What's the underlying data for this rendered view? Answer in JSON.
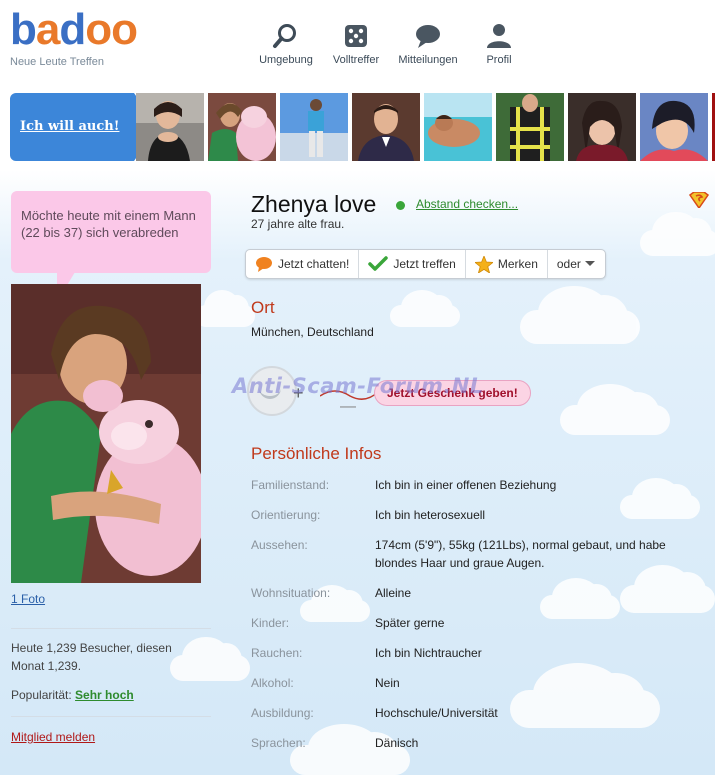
{
  "header": {
    "logo_letters": [
      "b",
      "a",
      "d",
      "o",
      "o"
    ],
    "tagline": "Neue Leute Treffen",
    "nav": [
      {
        "label": "Umgebung",
        "icon": "magnifier-icon"
      },
      {
        "label": "Volltreffer",
        "icon": "dice-icon"
      },
      {
        "label": "Mitteilungen",
        "icon": "speech-bubble-icon"
      },
      {
        "label": "Profil",
        "icon": "person-icon"
      }
    ]
  },
  "strip": {
    "cta": "Ich will auch!",
    "thumbnails": 8
  },
  "sidebar": {
    "status_bubble": "Möchte heute mit einem Mann (22 bis 37) sich verabreden",
    "photo_count_link": "1 Foto",
    "visitors": "Heute 1,239 Besucher, diesen Monat 1,239.",
    "popularity_label": "Popularität:",
    "popularity_value": "Sehr hoch",
    "report_link": "Mitglied melden"
  },
  "profile": {
    "name": "Zhenya love",
    "distance_link": "Abstand checken...",
    "age_line": "27 jahre alte frau.",
    "actions": [
      {
        "label": "Jetzt chatten!",
        "icon": "chat-bubble-icon"
      },
      {
        "label": "Jetzt treffen",
        "icon": "checkmark-icon"
      },
      {
        "label": "Merken",
        "icon": "star-icon"
      },
      {
        "label": "oder",
        "icon": "chevron-down-icon"
      }
    ],
    "location_heading": "Ort",
    "location": "München, Deutschland",
    "gift_button": "Jetzt Geschenk geben!",
    "plus": "+",
    "minus": "—",
    "watermark": "Anti-Scam-Forum.NL",
    "personal_heading": "Persönliche Infos",
    "info": [
      {
        "key": "Familienstand:",
        "value": "Ich bin in einer offenen Beziehung"
      },
      {
        "key": "Orientierung:",
        "value": "Ich bin heterosexuell"
      },
      {
        "key": "Aussehen:",
        "value": "174cm (5'9\"), 55kg (121Lbs), normal gebaut, und habe blondes Haar und graue Augen."
      },
      {
        "key": "Wohnsituation:",
        "value": "Alleine"
      },
      {
        "key": "Kinder:",
        "value": "Später gerne"
      },
      {
        "key": "Rauchen:",
        "value": "Ich bin Nichtraucher"
      },
      {
        "key": "Alkohol:",
        "value": "Nein"
      },
      {
        "key": "Ausbildung:",
        "value": "Hochschule/Universität"
      },
      {
        "key": "Sprachen:",
        "value": "Dänisch"
      }
    ]
  },
  "colors": {
    "logo": [
      "#3a6fc4",
      "#e9792a",
      "#3a6fc4",
      "#e9792a",
      "#e9792a"
    ],
    "brand_blue": "#3c86d9",
    "section_red": "#c0391b",
    "link_green": "#2e8b2e",
    "bubble_pink": "#fbc8e8"
  }
}
